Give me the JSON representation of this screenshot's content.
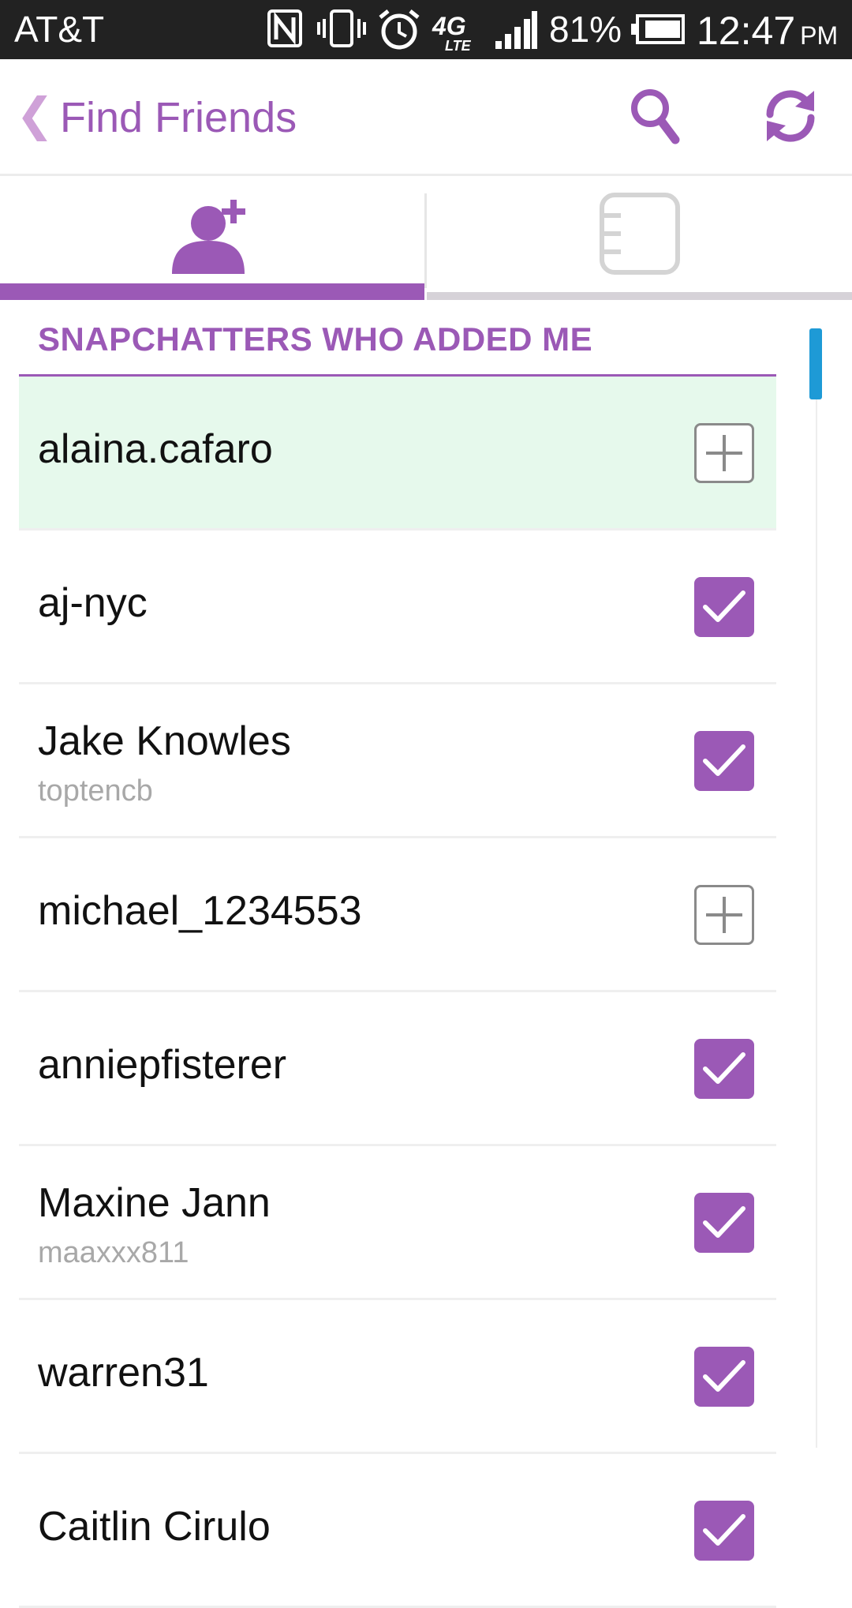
{
  "status_bar": {
    "carrier": "AT&T",
    "battery_percent": "81%",
    "time": "12:47",
    "ampm": "PM",
    "icons": [
      "nfc-icon",
      "vibrate-icon",
      "alarm-icon",
      "4g-lte-icon",
      "signal-icon",
      "battery-icon"
    ]
  },
  "header": {
    "back_icon": "chevron-left-icon",
    "title": "Find Friends",
    "search_icon": "search-icon",
    "refresh_icon": "refresh-icon"
  },
  "tabs": [
    {
      "icon": "add-friend-icon",
      "active": true
    },
    {
      "icon": "address-book-icon",
      "active": false
    }
  ],
  "section": {
    "title": "SNAPCHATTERS WHO ADDED ME"
  },
  "friends": [
    {
      "name": "alaina.cafaro",
      "username": "",
      "added": false,
      "highlight": true
    },
    {
      "name": "aj-nyc",
      "username": "",
      "added": true,
      "highlight": false
    },
    {
      "name": "Jake Knowles",
      "username": "toptencb",
      "added": true,
      "highlight": false
    },
    {
      "name": "michael_1234553",
      "username": "",
      "added": false,
      "highlight": false
    },
    {
      "name": "anniepfisterer",
      "username": "",
      "added": true,
      "highlight": false
    },
    {
      "name": "Maxine Jann",
      "username": "maaxxx811",
      "added": true,
      "highlight": false
    },
    {
      "name": "warren31",
      "username": "",
      "added": true,
      "highlight": false
    },
    {
      "name": "Caitlin Cirulo",
      "username": "",
      "added": true,
      "highlight": false
    }
  ],
  "colors": {
    "accent": "#9b59b6",
    "highlight_row": "#e6f9ec",
    "scroll_thumb": "#1e9ad6",
    "status_bar": "#222222"
  }
}
